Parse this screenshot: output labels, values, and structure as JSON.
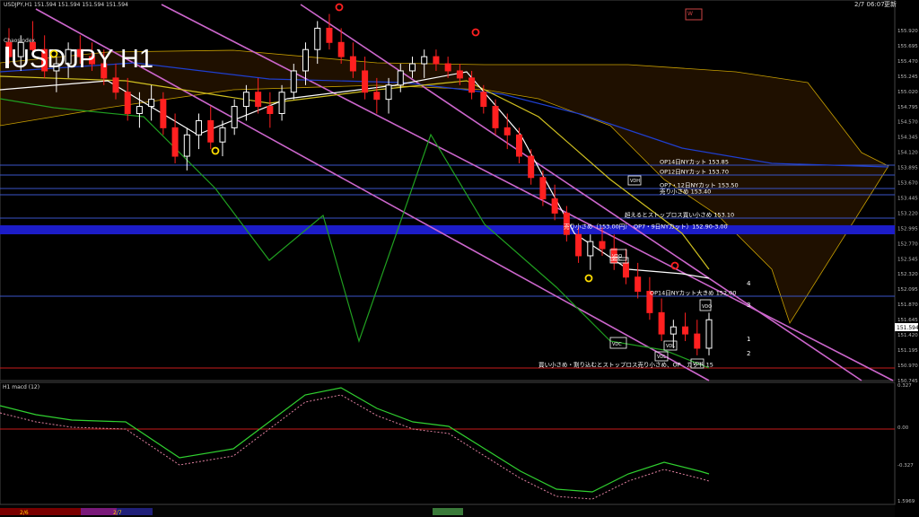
{
  "header": {
    "symbol_line": "USDJPY,H1  151.594 151.594 151.594 151.594",
    "indicator_tag": "ChaosIndex",
    "datetime": "2/7 06:07",
    "datetime_suffix": "更新",
    "big_title": "USDJPY H1"
  },
  "macd_label": "H1  macd (12)",
  "price_axis_ticks": [
    "155.920",
    "155.695",
    "155.470",
    "155.245",
    "155.020",
    "154.795",
    "154.570",
    "154.345",
    "154.120",
    "153.895",
    "153.670",
    "153.445",
    "153.220",
    "152.995",
    "152.770",
    "152.545",
    "152.320",
    "152.095",
    "151.870",
    "151.645",
    "151.420",
    "151.195",
    "150.970",
    "150.745"
  ],
  "macd_axis_ticks": [
    "0.327",
    "0.00",
    "-0.327",
    "1.5969"
  ],
  "current_price": "151.594",
  "levels": [
    {
      "label": "OP14日NYカット 153.85",
      "price": 153.85,
      "color": "#3a55c8"
    },
    {
      "label": "OP12日NYカット 153.70",
      "price": 153.7,
      "color": "#3a55c8"
    },
    {
      "label": "OP7・12日NYカット 153.50",
      "price": 153.5,
      "color": "#3a55c8"
    },
    {
      "label": "売り小さめ 153.40",
      "price": 153.4,
      "color": "#3a55c8"
    },
    {
      "label": "超えるとストップロス買い小さめ 153.10",
      "price": 153.1,
      "color": "#3a55c8"
    },
    {
      "label": "売り小さめ（153.00円）　OP7・9日NYカット）152.90-3.00",
      "price": 152.95,
      "color": "#1c1cc8"
    },
    {
      "label": "OP14日NYカット大きめ 152.00",
      "price": 152.0,
      "color": "#3a55c8"
    },
    {
      "label": "買い小さめ・割り込むとストップロス売り小さめ、OP　カット 15",
      "price": 151.1,
      "color": "#c81c1c"
    }
  ],
  "box_labels": [
    "VDO",
    "VDC",
    "VDL",
    "VDO",
    "VDC",
    "VDL",
    "VDH",
    "VDH"
  ],
  "wave_labels": [
    "1",
    "2",
    "3",
    "4"
  ],
  "session_labels": [
    "2/6",
    "2/7"
  ],
  "chart_data": {
    "type": "candlestick",
    "title": "USDJPY H1",
    "y_range": [
      150.745,
      155.92
    ],
    "ohlc": [
      [
        155.5,
        155.7,
        155.2,
        155.3
      ],
      [
        155.3,
        155.6,
        155.1,
        155.5
      ],
      [
        155.5,
        155.8,
        155.3,
        155.4
      ],
      [
        155.4,
        155.6,
        155.0,
        155.1
      ],
      [
        155.1,
        155.3,
        154.8,
        155.2
      ],
      [
        155.2,
        155.5,
        155.0,
        155.4
      ],
      [
        155.4,
        155.6,
        155.2,
        155.3
      ],
      [
        155.3,
        155.5,
        155.1,
        155.2
      ],
      [
        155.2,
        155.4,
        154.9,
        155.0
      ],
      [
        155.0,
        155.2,
        154.7,
        154.8
      ],
      [
        154.8,
        155.0,
        154.4,
        154.5
      ],
      [
        154.5,
        154.8,
        154.3,
        154.6
      ],
      [
        154.6,
        154.9,
        154.4,
        154.7
      ],
      [
        154.7,
        154.8,
        154.2,
        154.3
      ],
      [
        154.3,
        154.5,
        153.8,
        153.9
      ],
      [
        153.9,
        154.3,
        153.7,
        154.2
      ],
      [
        154.2,
        154.5,
        154.0,
        154.4
      ],
      [
        154.4,
        154.6,
        154.0,
        154.1
      ],
      [
        154.1,
        154.4,
        153.9,
        154.3
      ],
      [
        154.3,
        154.7,
        154.2,
        154.6
      ],
      [
        154.6,
        154.9,
        154.4,
        154.8
      ],
      [
        154.8,
        155.0,
        154.5,
        154.6
      ],
      [
        154.6,
        154.8,
        154.3,
        154.5
      ],
      [
        154.5,
        154.9,
        154.4,
        154.8
      ],
      [
        154.8,
        155.2,
        154.7,
        155.1
      ],
      [
        155.1,
        155.5,
        154.9,
        155.4
      ],
      [
        155.4,
        155.8,
        155.2,
        155.7
      ],
      [
        155.7,
        155.9,
        155.4,
        155.5
      ],
      [
        155.5,
        155.7,
        155.2,
        155.3
      ],
      [
        155.3,
        155.5,
        155.0,
        155.1
      ],
      [
        155.1,
        155.3,
        154.7,
        154.8
      ],
      [
        154.8,
        155.0,
        154.5,
        154.7
      ],
      [
        154.7,
        155.0,
        154.5,
        154.9
      ],
      [
        154.9,
        155.2,
        154.8,
        155.1
      ],
      [
        155.1,
        155.3,
        155.0,
        155.2
      ],
      [
        155.2,
        155.4,
        155.0,
        155.3
      ],
      [
        155.3,
        155.4,
        155.1,
        155.2
      ],
      [
        155.2,
        155.3,
        155.0,
        155.1
      ],
      [
        155.1,
        155.2,
        154.9,
        155.0
      ],
      [
        155.0,
        155.1,
        154.7,
        154.8
      ],
      [
        154.8,
        154.9,
        154.5,
        154.6
      ],
      [
        154.6,
        154.7,
        154.2,
        154.3
      ],
      [
        154.3,
        154.5,
        154.0,
        154.2
      ],
      [
        154.2,
        154.3,
        153.8,
        153.9
      ],
      [
        153.9,
        154.0,
        153.5,
        153.6
      ],
      [
        153.6,
        153.7,
        153.2,
        153.3
      ],
      [
        153.3,
        153.5,
        153.0,
        153.1
      ],
      [
        153.1,
        153.2,
        152.7,
        152.8
      ],
      [
        152.8,
        152.9,
        152.4,
        152.5
      ],
      [
        152.5,
        152.8,
        152.3,
        152.7
      ],
      [
        152.7,
        152.9,
        152.5,
        152.6
      ],
      [
        152.6,
        152.8,
        152.3,
        152.4
      ],
      [
        152.4,
        152.6,
        152.1,
        152.2
      ],
      [
        152.2,
        152.4,
        151.9,
        152.0
      ],
      [
        152.0,
        152.2,
        151.6,
        151.7
      ],
      [
        151.7,
        151.9,
        151.3,
        151.4
      ],
      [
        151.4,
        151.6,
        151.2,
        151.5
      ],
      [
        151.5,
        151.7,
        151.3,
        151.4
      ],
      [
        151.4,
        151.6,
        151.1,
        151.2
      ],
      [
        151.2,
        151.7,
        151.1,
        151.6
      ]
    ],
    "overlays": [
      "Ichimoku cloud",
      "moving averages",
      "descending channel"
    ],
    "grid": false
  }
}
